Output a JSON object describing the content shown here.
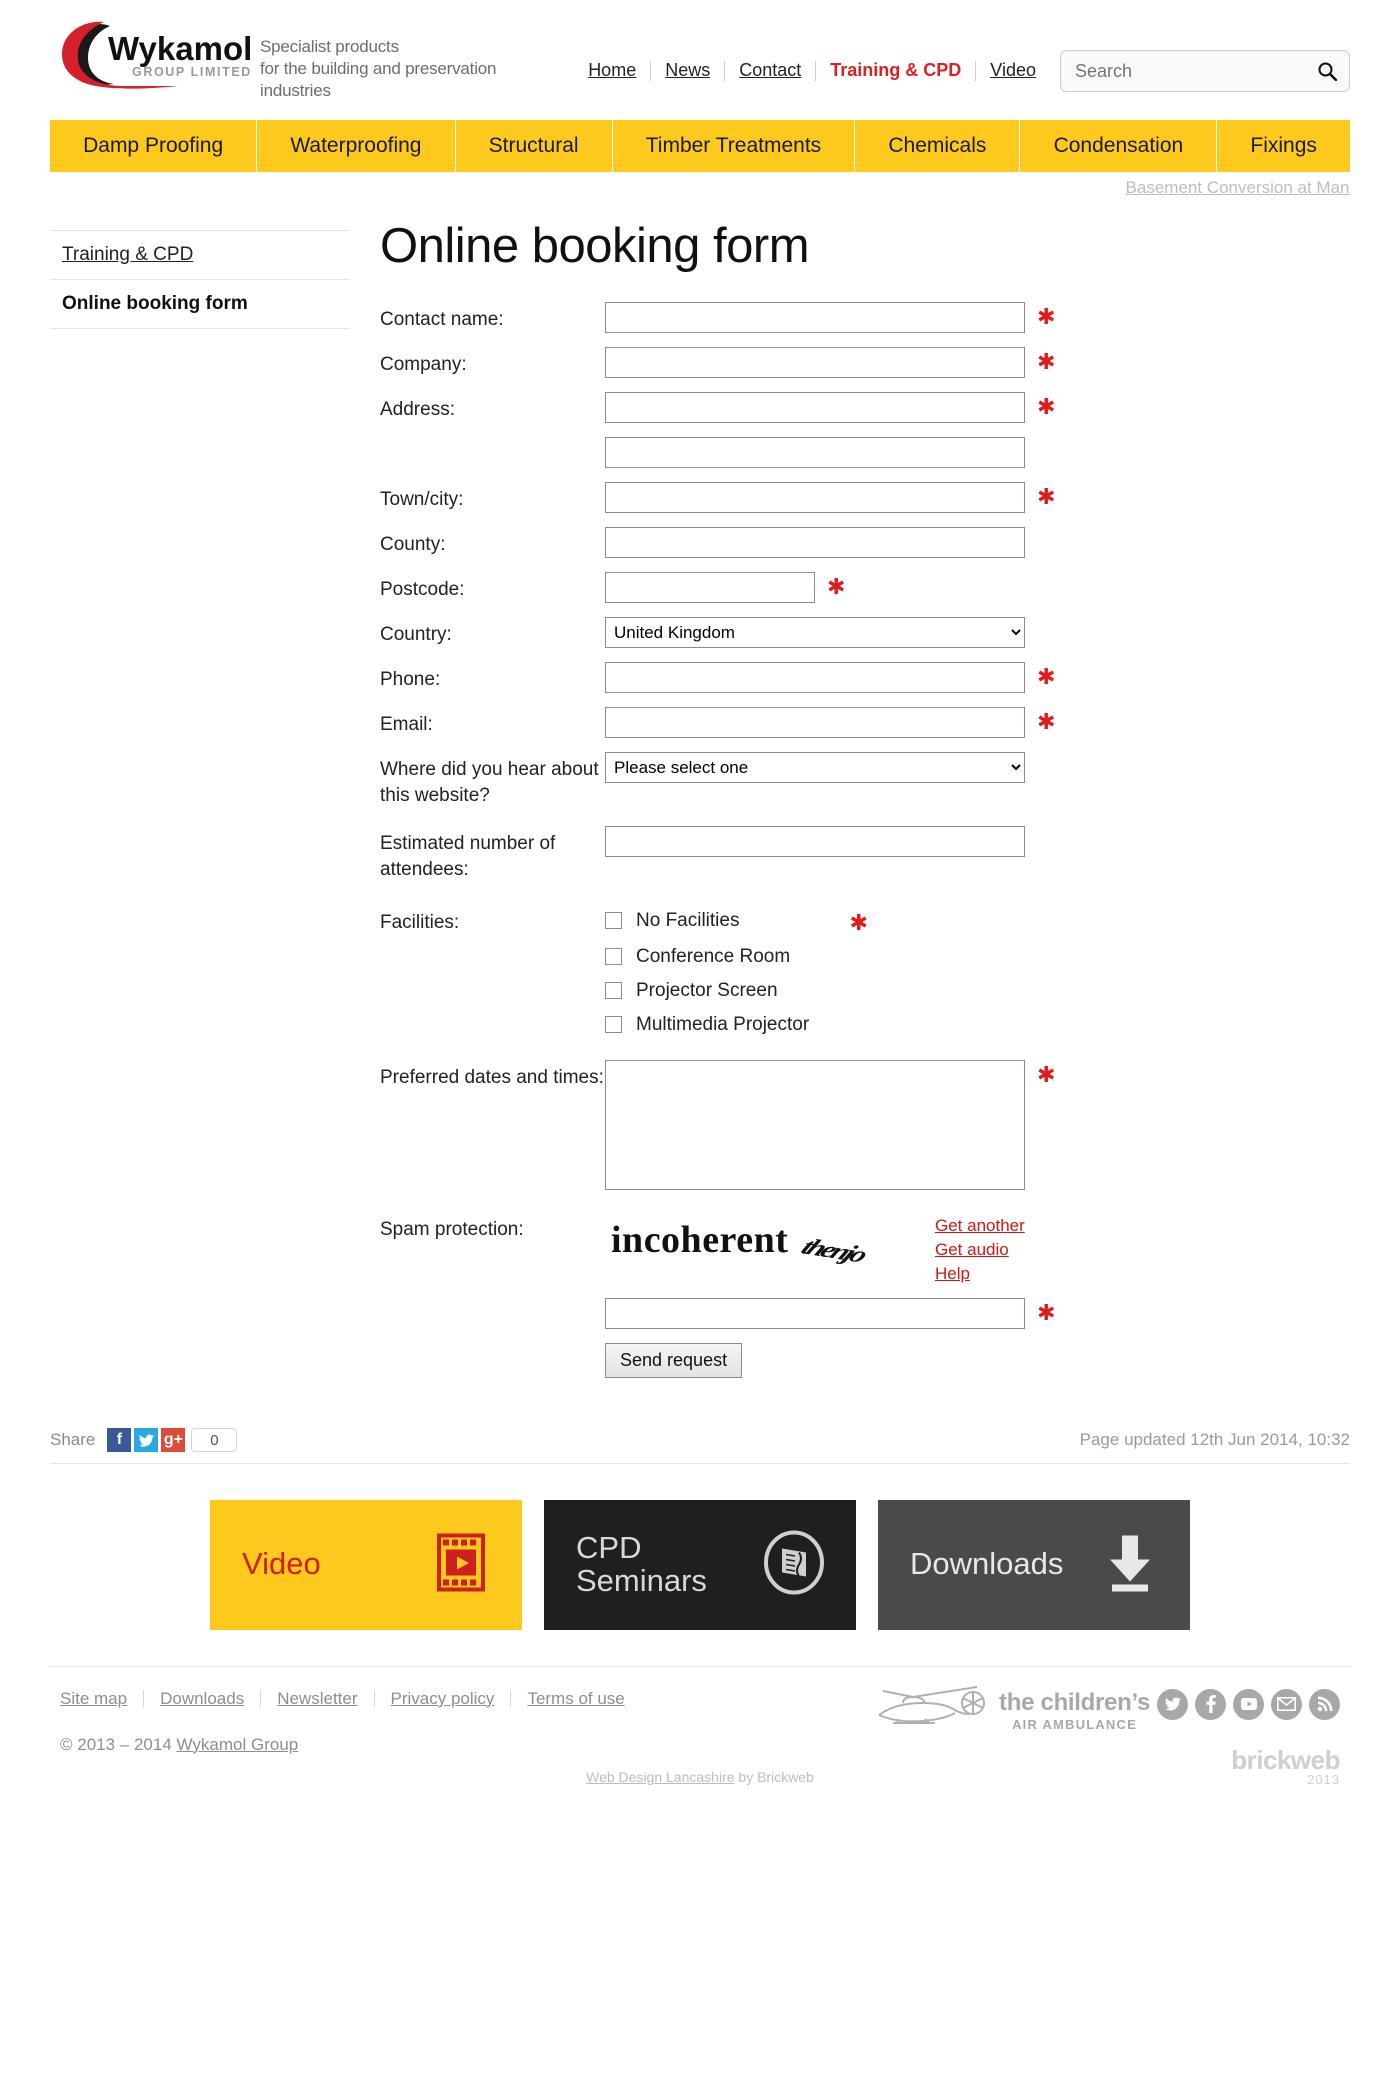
{
  "brand": {
    "name": "Wykamol",
    "sub": "GROUP LIMITED",
    "tagline": "Specialist products\nfor the building and preservation\nindustries"
  },
  "topnav": {
    "items": [
      {
        "label": "Home",
        "active": false
      },
      {
        "label": "News",
        "active": false
      },
      {
        "label": "Contact",
        "active": false
      },
      {
        "label": "Training & CPD",
        "active": true
      },
      {
        "label": "Video",
        "active": false
      }
    ]
  },
  "search": {
    "placeholder": "Search",
    "value": ""
  },
  "mainnav": {
    "items": [
      "Damp Proofing",
      "Waterproofing",
      "Structural",
      "Timber Treatments",
      "Chemicals",
      "Condensation",
      "Fixings"
    ]
  },
  "ticker": {
    "text": "Basement Conversion at Manc"
  },
  "sidebar": {
    "items": [
      {
        "label": "Training & CPD",
        "current": false
      },
      {
        "label": "Online booking form",
        "current": true
      }
    ]
  },
  "main": {
    "title": "Online booking form",
    "fields": {
      "contact_name": {
        "label": "Contact name:",
        "value": "",
        "required": true
      },
      "company": {
        "label": "Company:",
        "value": "",
        "required": true
      },
      "address": {
        "label": "Address:",
        "value": "",
        "required": true
      },
      "address2": {
        "label": "",
        "value": "",
        "required": false
      },
      "town": {
        "label": "Town/city:",
        "value": "",
        "required": true
      },
      "county": {
        "label": "County:",
        "value": "",
        "required": false
      },
      "postcode": {
        "label": "Postcode:",
        "value": "",
        "required": true
      },
      "country": {
        "label": "Country:",
        "value": "United Kingdom",
        "required": false,
        "options": [
          "United Kingdom"
        ]
      },
      "phone": {
        "label": "Phone:",
        "value": "",
        "required": true
      },
      "email": {
        "label": "Email:",
        "value": "",
        "required": true
      },
      "referrer": {
        "label": "Where did you hear about this website?",
        "value": "Please select one",
        "required": false,
        "options": [
          "Please select one"
        ]
      },
      "attendees": {
        "label": "Estimated number of attendees:",
        "value": "",
        "required": false
      },
      "facilities": {
        "label": "Facilities:",
        "required": true,
        "options": [
          {
            "label": "No Facilities",
            "checked": false
          },
          {
            "label": "Conference Room",
            "checked": false
          },
          {
            "label": "Projector Screen",
            "checked": false
          },
          {
            "label": "Multimedia Projector",
            "checked": false
          }
        ]
      },
      "preferred": {
        "label": "Preferred dates and times:",
        "value": "",
        "required": true
      },
      "spam": {
        "label": "Spam protection:",
        "value": "",
        "required": true,
        "captcha_word": "incoherent",
        "captcha_word2": "thenjo",
        "links": [
          "Get another",
          "Get audio",
          "Help"
        ]
      }
    },
    "submit_label": "Send request",
    "required_marker": "✱"
  },
  "share": {
    "label": "Share",
    "facebook": "f",
    "twitter": "t",
    "googleplus": "g+",
    "count": "0",
    "updated": "Page updated 12th Jun 2014, 10:32"
  },
  "promos": [
    {
      "label": "Video",
      "icon": "film-strip-play-icon"
    },
    {
      "label": "CPD\nSeminars",
      "icon": "seminar-book-icon"
    },
    {
      "label": "Downloads",
      "icon": "download-arrow-icon"
    }
  ],
  "footer": {
    "links": [
      "Site map",
      "Downloads",
      "Newsletter",
      "Privacy policy",
      "Terms of use"
    ],
    "copyright_prefix": "© 2013 – 2014 ",
    "copyright_link": "Wykamol Group",
    "charity": {
      "line1": "the children’s",
      "line2": "AIR AMBULANCE"
    },
    "social": [
      "twitter-icon",
      "facebook-icon",
      "youtube-icon",
      "email-icon",
      "rss-icon"
    ],
    "brickweb": {
      "name": "brickweb",
      "year": "2013"
    },
    "credit_link": "Web Design Lancashire",
    "credit_suffix": " by Brickweb"
  },
  "colors": {
    "nav_yellow": "#FCC91C",
    "accent_red": "#e02020",
    "required_red": "#e01b1b",
    "link_grey": "#8e8e8e"
  }
}
